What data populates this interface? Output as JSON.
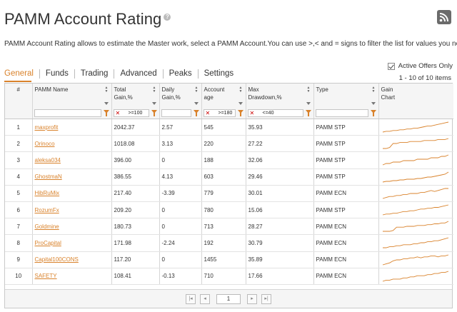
{
  "page": {
    "title": "PAMM Account Rating",
    "help_glyph": "?",
    "description": "PAMM Account Rating allows to estimate the Master work, select a PAMM Account.You can use >,< and = signs to filter the list for values you need!",
    "active_offers_label": "Active Offers Only",
    "active_offers_checked": true,
    "count_label": "1 - 10 of 10 items"
  },
  "tabs": [
    {
      "label": "General",
      "active": true
    },
    {
      "label": "Funds",
      "active": false
    },
    {
      "label": "Trading",
      "active": false
    },
    {
      "label": "Advanced",
      "active": false
    },
    {
      "label": "Peaks",
      "active": false
    },
    {
      "label": "Settings",
      "active": false
    }
  ],
  "columns": {
    "num": "#",
    "name": "PAMM Name",
    "total_gain": "Total\nGain,%",
    "daily_gain": "Daily\nGain,%",
    "account_age": "Account\nage",
    "max_drawdown": "Max\nDrawdown,%",
    "type": "Type",
    "gain_chart": "Gain\nChart"
  },
  "filters": {
    "total_gain": ">=100",
    "account_age": ">=180",
    "max_drawdown": "<=40"
  },
  "rows": [
    {
      "num": "1",
      "name": "maxprofit",
      "total_gain": "2042.37",
      "daily_gain": "2.57",
      "age": "545",
      "drawdown": "35.93",
      "type": "PAMM STP",
      "spark": [
        2,
        3,
        3,
        4,
        4,
        5,
        5,
        6,
        6,
        7,
        7,
        8,
        9,
        10,
        10,
        11,
        12,
        13,
        14,
        15
      ]
    },
    {
      "num": "2",
      "name": "Orinoco",
      "total_gain": "1018.08",
      "daily_gain": "3.13",
      "age": "220",
      "drawdown": "27.22",
      "type": "PAMM STP",
      "spark": [
        1,
        1,
        2,
        6,
        6,
        7,
        7,
        7,
        8,
        8,
        8,
        8,
        9,
        9,
        9,
        9,
        10,
        10,
        10,
        11
      ]
    },
    {
      "num": "3",
      "name": "aleksa034",
      "total_gain": "396.00",
      "daily_gain": "0",
      "age": "188",
      "drawdown": "32.06",
      "type": "PAMM STP",
      "spark": [
        3,
        4,
        4,
        5,
        5,
        5,
        6,
        6,
        6,
        6,
        7,
        7,
        7,
        7,
        8,
        8,
        8,
        9,
        9,
        10
      ]
    },
    {
      "num": "4",
      "name": "GhostmaN",
      "total_gain": "386.55",
      "daily_gain": "4.13",
      "age": "603",
      "drawdown": "29.46",
      "type": "PAMM STP",
      "spark": [
        1,
        2,
        2,
        3,
        3,
        4,
        4,
        5,
        5,
        5,
        6,
        6,
        7,
        8,
        8,
        9,
        10,
        11,
        12,
        15
      ]
    },
    {
      "num": "5",
      "name": "HibRuMix",
      "total_gain": "217.40",
      "daily_gain": "-3.39",
      "age": "779",
      "drawdown": "30.01",
      "type": "PAMM ECN",
      "spark": [
        3,
        4,
        5,
        5,
        6,
        6,
        7,
        7,
        8,
        8,
        8,
        9,
        9,
        10,
        11,
        10,
        11,
        12,
        13,
        13
      ]
    },
    {
      "num": "6",
      "name": "RozumFx",
      "total_gain": "209.20",
      "daily_gain": "0",
      "age": "780",
      "drawdown": "15.06",
      "type": "PAMM STP",
      "spark": [
        2,
        3,
        3,
        4,
        4,
        5,
        6,
        6,
        7,
        7,
        8,
        9,
        9,
        10,
        10,
        11,
        11,
        12,
        13,
        14
      ]
    },
    {
      "num": "7",
      "name": "Goldmine",
      "total_gain": "180.73",
      "daily_gain": "0",
      "age": "713",
      "drawdown": "28.27",
      "type": "PAMM ECN",
      "spark": [
        1,
        1,
        1,
        2,
        6,
        6,
        6,
        7,
        7,
        7,
        8,
        8,
        8,
        9,
        9,
        10,
        10,
        11,
        11,
        13
      ]
    },
    {
      "num": "8",
      "name": "ProCapital",
      "total_gain": "171.98",
      "daily_gain": "-2.24",
      "age": "192",
      "drawdown": "30.79",
      "type": "PAMM ECN",
      "spark": [
        2,
        2,
        3,
        3,
        4,
        4,
        5,
        5,
        5,
        6,
        6,
        7,
        7,
        8,
        8,
        9,
        9,
        10,
        11,
        12
      ]
    },
    {
      "num": "9",
      "name": "Capital100CONS",
      "total_gain": "117.20",
      "daily_gain": "0",
      "age": "1455",
      "drawdown": "35.89",
      "type": "PAMM ECN",
      "spark": [
        1,
        2,
        3,
        5,
        6,
        6,
        7,
        7,
        8,
        8,
        9,
        8,
        9,
        9,
        10,
        10,
        9,
        10,
        10,
        11
      ]
    },
    {
      "num": "10",
      "name": "SAFETY",
      "total_gain": "108.41",
      "daily_gain": "-0.13",
      "age": "710",
      "drawdown": "17.66",
      "type": "PAMM ECN",
      "spark": [
        1,
        2,
        2,
        3,
        3,
        3,
        4,
        4,
        5,
        5,
        6,
        6,
        6,
        7,
        7,
        8,
        8,
        9,
        9,
        10
      ]
    }
  ],
  "pager": {
    "current_page": "1",
    "first_glyph": "|◂",
    "prev_glyph": "◂",
    "next_glyph": "▸",
    "last_glyph": "▸|"
  },
  "colors": {
    "accent": "#d9822b",
    "filter_x": "#cc0000"
  },
  "icons": {
    "rss": "rss-icon",
    "help": "help-icon",
    "sort": "sort-arrows-icon",
    "filter": "filter-funnel-icon",
    "clear": "clear-filter-icon"
  }
}
